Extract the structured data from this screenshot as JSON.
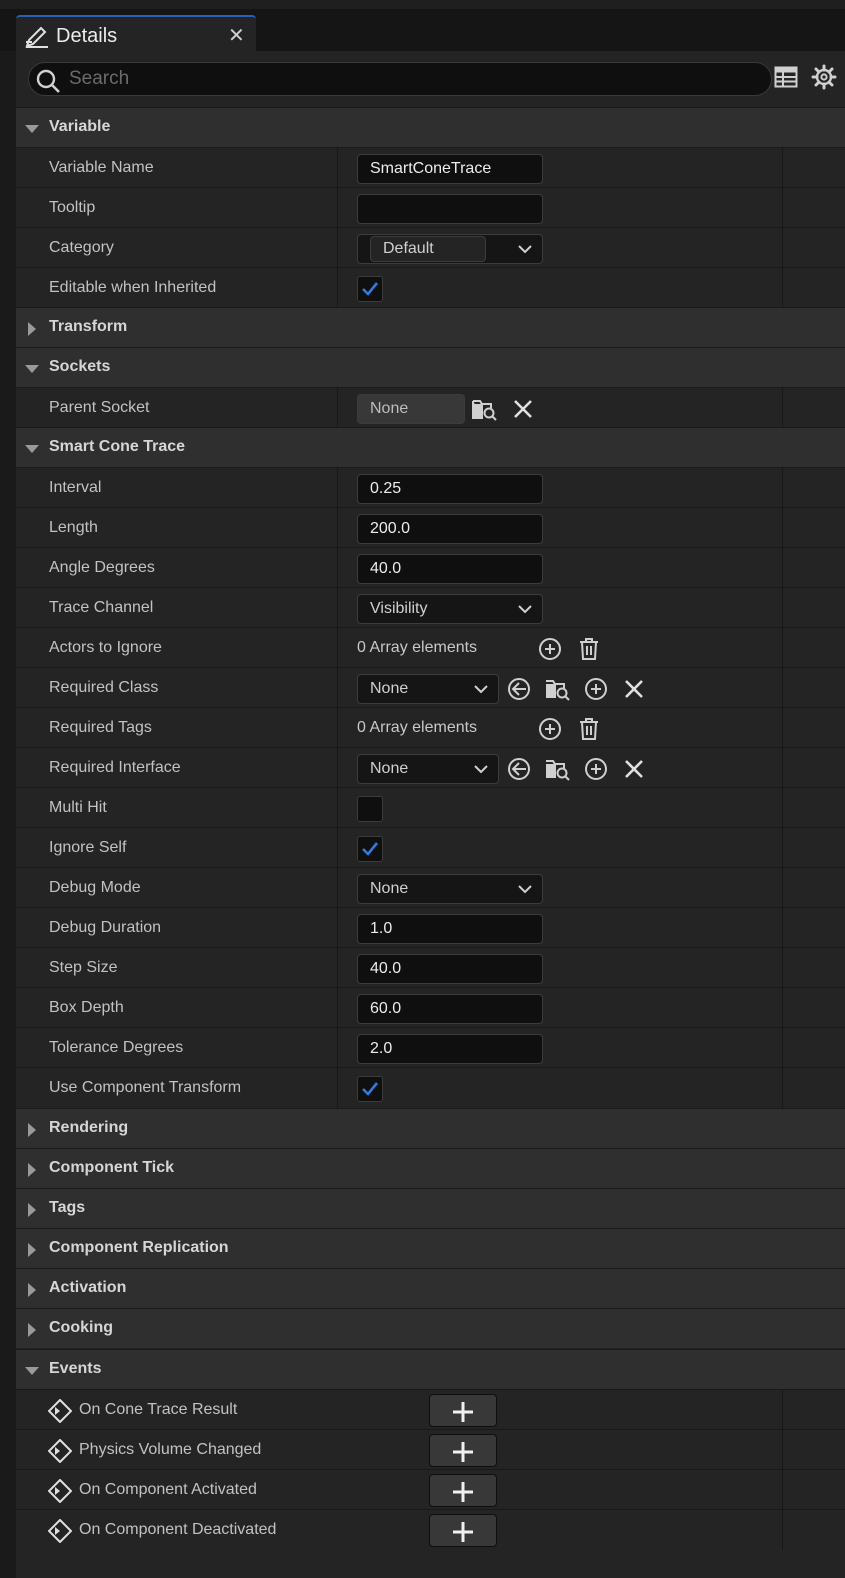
{
  "window": {
    "tab_title": "Details"
  },
  "search": {
    "placeholder": "Search"
  },
  "toolbar_icons": [
    "table-view-icon",
    "gear-icon"
  ],
  "sections": {
    "variable": {
      "label": "Variable",
      "variable_name": {
        "label": "Variable Name",
        "value": "SmartConeTrace"
      },
      "tooltip": {
        "label": "Tooltip",
        "value": ""
      },
      "category": {
        "label": "Category",
        "value": "Default"
      },
      "editable_inherited": {
        "label": "Editable when Inherited",
        "checked": true
      }
    },
    "transform": {
      "label": "Transform"
    },
    "sockets": {
      "label": "Sockets",
      "parent_socket": {
        "label": "Parent Socket",
        "value": "None"
      }
    },
    "smart_cone_trace": {
      "label": "Smart Cone Trace",
      "interval": {
        "label": "Interval",
        "value": "0.25"
      },
      "length": {
        "label": "Length",
        "value": "200.0"
      },
      "angle_degrees": {
        "label": "Angle Degrees",
        "value": "40.0"
      },
      "trace_channel": {
        "label": "Trace Channel",
        "value": "Visibility"
      },
      "actors_to_ignore": {
        "label": "Actors to Ignore",
        "value": "0 Array elements"
      },
      "required_class": {
        "label": "Required Class",
        "value": "None"
      },
      "required_tags": {
        "label": "Required Tags",
        "value": "0 Array elements"
      },
      "required_interface": {
        "label": "Required Interface",
        "value": "None"
      },
      "multi_hit": {
        "label": "Multi Hit",
        "checked": false
      },
      "ignore_self": {
        "label": "Ignore Self",
        "checked": true
      },
      "debug_mode": {
        "label": "Debug Mode",
        "value": "None"
      },
      "debug_duration": {
        "label": "Debug Duration",
        "value": "1.0"
      },
      "step_size": {
        "label": "Step Size",
        "value": "40.0"
      },
      "box_depth": {
        "label": "Box Depth",
        "value": "60.0"
      },
      "tolerance_degrees": {
        "label": "Tolerance Degrees",
        "value": "2.0"
      },
      "use_component_transform": {
        "label": "Use Component Transform",
        "checked": true
      }
    },
    "rendering": {
      "label": "Rendering"
    },
    "component_tick": {
      "label": "Component Tick"
    },
    "tags": {
      "label": "Tags"
    },
    "component_replication": {
      "label": "Component Replication"
    },
    "activation": {
      "label": "Activation"
    },
    "cooking": {
      "label": "Cooking"
    },
    "events": {
      "label": "Events",
      "items": [
        "On Cone Trace Result",
        "Physics Volume Changed",
        "On Component Activated",
        "On Component Deactivated"
      ]
    }
  },
  "colors": {
    "accent": "#2f7be0",
    "panel_bg": "#242424",
    "category_bg": "#2f2f2f",
    "field_bg": "#0f0f0f"
  }
}
